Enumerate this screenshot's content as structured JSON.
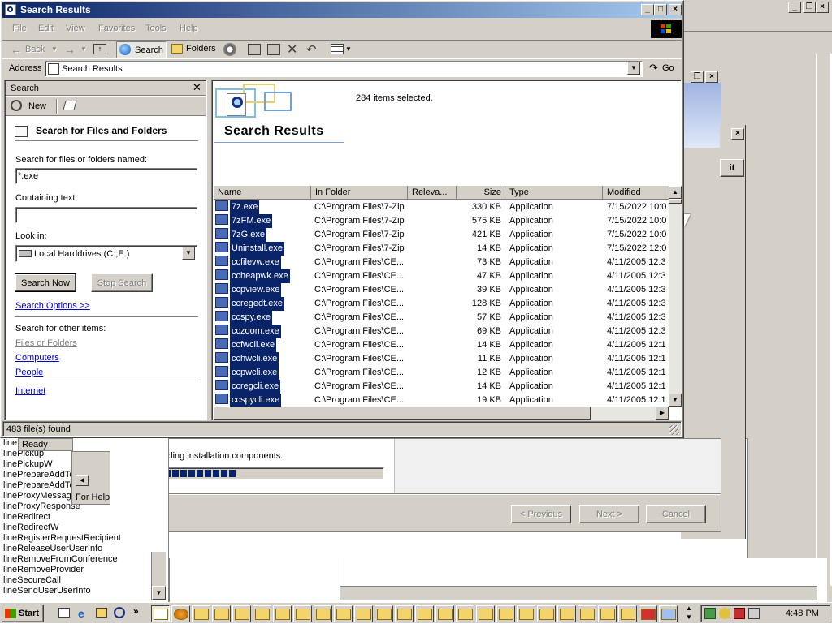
{
  "search_window": {
    "title": "Search Results",
    "menu": [
      "File",
      "Edit",
      "View",
      "Favorites",
      "Tools",
      "Help"
    ],
    "toolbar": {
      "back": "Back",
      "search": "Search",
      "folders": "Folders"
    },
    "address_label": "Address",
    "address_value": "Search Results",
    "go_label": "Go",
    "pane": {
      "title": "Search",
      "new_label": "New",
      "heading": "Search for Files and Folders",
      "named_label": "Search for files or folders named:",
      "named_value": "*.exe",
      "containing_label": "Containing text:",
      "containing_value": "",
      "look_in_label": "Look in:",
      "look_in_value": "Local Harddrives (C:;E:)",
      "search_now": "Search Now",
      "stop_search": "Stop Search",
      "search_options": "Search Options  >>",
      "other_items_label": "Search for other items:",
      "other_items": [
        "Files or Folders",
        "Computers",
        "People"
      ],
      "internet": "Internet"
    },
    "results": {
      "banner_title": "Search Results",
      "selected_text": "284 items selected.",
      "columns": [
        "Name",
        "In Folder",
        "Releva...",
        "Size",
        "Type",
        "Modified"
      ],
      "rows": [
        {
          "name": "7z.exe",
          "folder": "C:\\Program Files\\7-Zip",
          "size": "330 KB",
          "type": "Application",
          "modified": "7/15/2022 10:0"
        },
        {
          "name": "7zFM.exe",
          "folder": "C:\\Program Files\\7-Zip",
          "size": "575 KB",
          "type": "Application",
          "modified": "7/15/2022 10:0"
        },
        {
          "name": "7zG.exe",
          "folder": "C:\\Program Files\\7-Zip",
          "size": "421 KB",
          "type": "Application",
          "modified": "7/15/2022 10:0"
        },
        {
          "name": "Uninstall.exe",
          "folder": "C:\\Program Files\\7-Zip",
          "size": "14 KB",
          "type": "Application",
          "modified": "7/15/2022 12:0"
        },
        {
          "name": "ccfilevw.exe",
          "folder": "C:\\Program Files\\CE...",
          "size": "73 KB",
          "type": "Application",
          "modified": "4/11/2005 12:3"
        },
        {
          "name": "ccheapwk.exe",
          "folder": "C:\\Program Files\\CE...",
          "size": "47 KB",
          "type": "Application",
          "modified": "4/11/2005 12:3"
        },
        {
          "name": "ccpview.exe",
          "folder": "C:\\Program Files\\CE...",
          "size": "39 KB",
          "type": "Application",
          "modified": "4/11/2005 12:3"
        },
        {
          "name": "ccregedt.exe",
          "folder": "C:\\Program Files\\CE...",
          "size": "128 KB",
          "type": "Application",
          "modified": "4/11/2005 12:3"
        },
        {
          "name": "ccspy.exe",
          "folder": "C:\\Program Files\\CE...",
          "size": "57 KB",
          "type": "Application",
          "modified": "4/11/2005 12:3"
        },
        {
          "name": "cczoom.exe",
          "folder": "C:\\Program Files\\CE...",
          "size": "69 KB",
          "type": "Application",
          "modified": "4/11/2005 12:3"
        },
        {
          "name": "ccfwcli.exe",
          "folder": "C:\\Program Files\\CE...",
          "size": "14 KB",
          "type": "Application",
          "modified": "4/11/2005 12:1"
        },
        {
          "name": "cchwcli.exe",
          "folder": "C:\\Program Files\\CE...",
          "size": "11 KB",
          "type": "Application",
          "modified": "4/11/2005 12:1"
        },
        {
          "name": "ccpwcli.exe",
          "folder": "C:\\Program Files\\CE...",
          "size": "12 KB",
          "type": "Application",
          "modified": "4/11/2005 12:1"
        },
        {
          "name": "ccregcli.exe",
          "folder": "C:\\Program Files\\CE...",
          "size": "14 KB",
          "type": "Application",
          "modified": "4/11/2005 12:1"
        },
        {
          "name": "ccspycli.exe",
          "folder": "C:\\Program Files\\CE...",
          "size": "19 KB",
          "type": "Application",
          "modified": "4/11/2005 12:1"
        }
      ]
    },
    "status": "483 file(s) found"
  },
  "setup_dialog": {
    "loading_text": "Setup is loading installation components.",
    "progress_fraction": 0.44,
    "prev_label": "< Previous",
    "next_label": "Next >",
    "cancel_label": "Cancel",
    "partial_button": "it"
  },
  "help_window": {
    "ready": "Ready",
    "for_help": "For Help",
    "functions": [
      "line",
      "linePickup",
      "linePickupW",
      "linePrepareAddTo",
      "linePrepareAddTo",
      "lineProxyMessage",
      "lineProxyResponse",
      "lineRedirect",
      "lineRedirectW",
      "lineRegisterRequestRecipient",
      "lineReleaseUserUserInfo",
      "lineRemoveFromConference",
      "lineRemoveProvider",
      "lineSecureCall",
      "lineSendUserUserInfo"
    ]
  },
  "taskbar": {
    "start_label": "Start",
    "clock": "4:48 PM"
  },
  "colors": {
    "title_active": "#0a246a",
    "title_gradient_end": "#a6caf0",
    "selection": "#0a246a",
    "face": "#d4d0c8",
    "progress": "#0a246a"
  }
}
